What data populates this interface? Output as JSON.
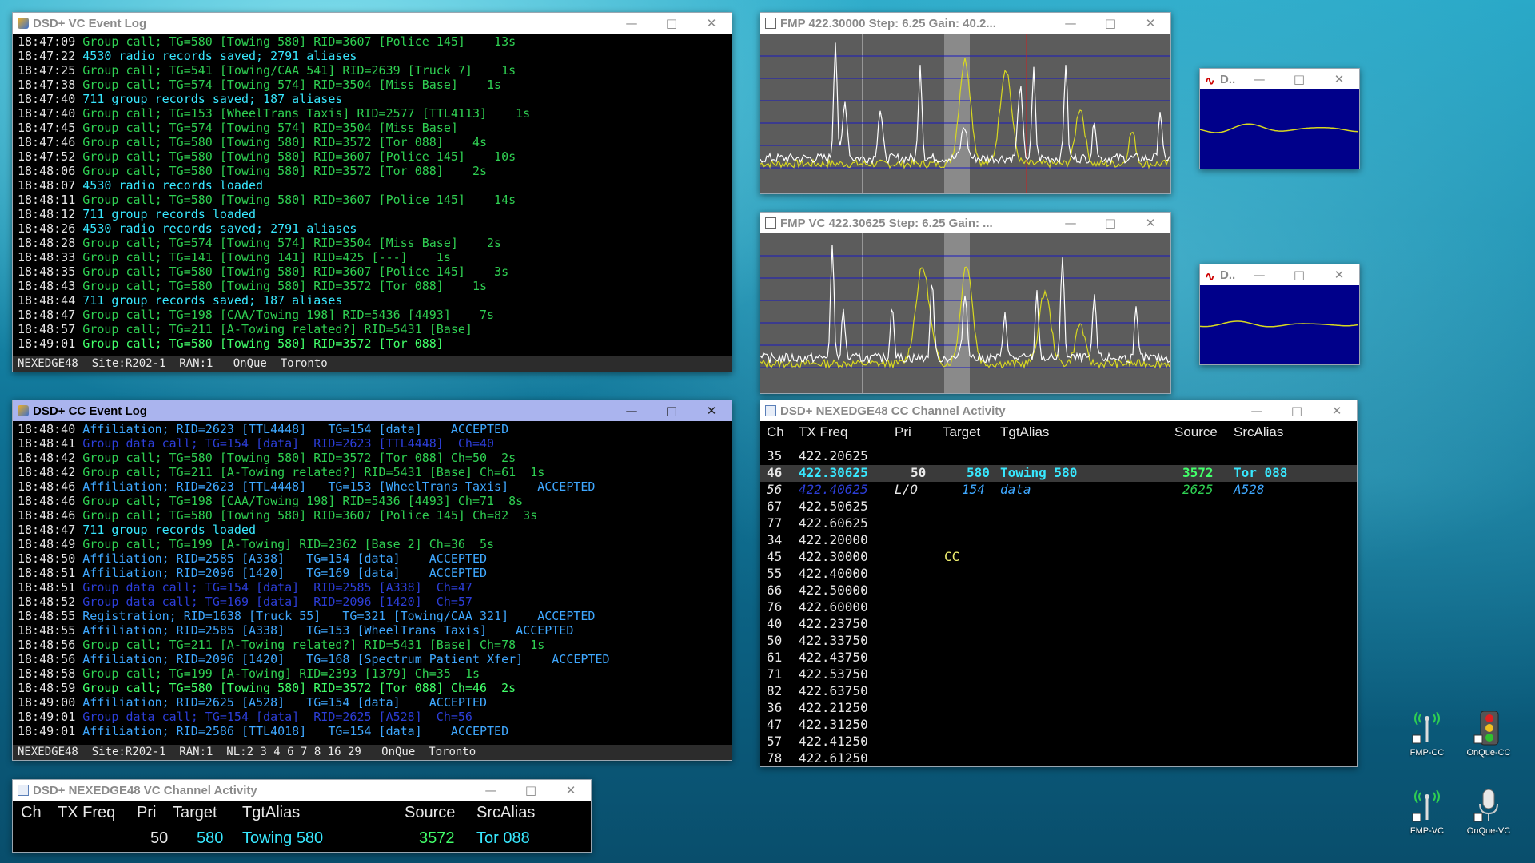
{
  "vc_log": {
    "title": "DSD+ VC Event Log",
    "lines": [
      {
        "t": "18:47:09",
        "m": "Group call; TG=580 [Towing 580] RID=3607 [Police 145]    13s",
        "c": "green"
      },
      {
        "t": "18:47:22",
        "m": "4530 radio records saved; 2791 aliases",
        "c": "cyan"
      },
      {
        "t": "18:47:25",
        "m": "Group call; TG=541 [Towing/CAA 541] RID=2639 [Truck 7]    1s",
        "c": "green"
      },
      {
        "t": "18:47:38",
        "m": "Group call; TG=574 [Towing 574] RID=3504 [Miss Base]    1s",
        "c": "green"
      },
      {
        "t": "18:47:40",
        "m": "711 group records saved; 187 aliases",
        "c": "cyan"
      },
      {
        "t": "18:47:40",
        "m": "Group call; TG=153 [WheelTrans Taxis] RID=2577 [TTL4113]    1s",
        "c": "green"
      },
      {
        "t": "18:47:45",
        "m": "Group call; TG=574 [Towing 574] RID=3504 [Miss Base]",
        "c": "green"
      },
      {
        "t": "18:47:46",
        "m": "Group call; TG=580 [Towing 580] RID=3572 [Tor 088]    4s",
        "c": "green"
      },
      {
        "t": "18:47:52",
        "m": "Group call; TG=580 [Towing 580] RID=3607 [Police 145]    10s",
        "c": "green"
      },
      {
        "t": "18:48:06",
        "m": "Group call; TG=580 [Towing 580] RID=3572 [Tor 088]    2s",
        "c": "green"
      },
      {
        "t": "18:48:07",
        "m": "4530 radio records loaded",
        "c": "cyan"
      },
      {
        "t": "18:48:11",
        "m": "Group call; TG=580 [Towing 580] RID=3607 [Police 145]    14s",
        "c": "green"
      },
      {
        "t": "18:48:12",
        "m": "711 group records loaded",
        "c": "cyan"
      },
      {
        "t": "18:48:26",
        "m": "4530 radio records saved; 2791 aliases",
        "c": "cyan"
      },
      {
        "t": "18:48:28",
        "m": "Group call; TG=574 [Towing 574] RID=3504 [Miss Base]    2s",
        "c": "green"
      },
      {
        "t": "18:48:33",
        "m": "Group call; TG=141 [Towing 141] RID=425 [---]    1s",
        "c": "green"
      },
      {
        "t": "18:48:35",
        "m": "Group call; TG=580 [Towing 580] RID=3607 [Police 145]    3s",
        "c": "green"
      },
      {
        "t": "18:48:43",
        "m": "Group call; TG=580 [Towing 580] RID=3572 [Tor 088]    1s",
        "c": "green"
      },
      {
        "t": "18:48:44",
        "m": "711 group records saved; 187 aliases",
        "c": "cyan"
      },
      {
        "t": "18:48:47",
        "m": "Group call; TG=198 [CAA/Towing 198] RID=5436 [4493]    7s",
        "c": "green"
      },
      {
        "t": "18:48:57",
        "m": "Group call; TG=211 [A-Towing related?] RID=5431 [Base]",
        "c": "green"
      },
      {
        "t": "18:49:01",
        "m": "Group call; TG=580 [Towing 580] RID=3572 [Tor 088]",
        "c": "bright"
      }
    ],
    "status": "NEXEDGE48  Site:R202-1  RAN:1   OnQue  Toronto"
  },
  "cc_log": {
    "title": "DSD+ CC Event Log",
    "lines": [
      {
        "t": "18:48:40",
        "m": "Affiliation; RID=2623 [TTL4448]   TG=154 [data]    ACCEPTED",
        "c": "aff"
      },
      {
        "t": "18:48:41",
        "m": "Group data call; TG=154 [data]  RID=2623 [TTL4448]  Ch=40",
        "c": "blue"
      },
      {
        "t": "18:48:42",
        "m": "Group call; TG=580 [Towing 580] RID=3572 [Tor 088] Ch=50  2s",
        "c": "green"
      },
      {
        "t": "18:48:42",
        "m": "Group call; TG=211 [A-Towing related?] RID=5431 [Base] Ch=61  1s",
        "c": "green"
      },
      {
        "t": "18:48:46",
        "m": "Affiliation; RID=2623 [TTL4448]   TG=153 [WheelTrans Taxis]    ACCEPTED",
        "c": "aff"
      },
      {
        "t": "18:48:46",
        "m": "Group call; TG=198 [CAA/Towing 198] RID=5436 [4493] Ch=71  8s",
        "c": "green"
      },
      {
        "t": "18:48:46",
        "m": "Group call; TG=580 [Towing 580] RID=3607 [Police 145] Ch=82  3s",
        "c": "green"
      },
      {
        "t": "18:48:47",
        "m": "711 group records loaded",
        "c": "cyan"
      },
      {
        "t": "18:48:49",
        "m": "Group call; TG=199 [A-Towing] RID=2362 [Base 2] Ch=36  5s",
        "c": "green"
      },
      {
        "t": "18:48:50",
        "m": "Affiliation; RID=2585 [A338]   TG=154 [data]    ACCEPTED",
        "c": "aff"
      },
      {
        "t": "18:48:51",
        "m": "Affiliation; RID=2096 [1420]   TG=169 [data]    ACCEPTED",
        "c": "aff"
      },
      {
        "t": "18:48:51",
        "m": "Group data call; TG=154 [data]  RID=2585 [A338]  Ch=47",
        "c": "blue"
      },
      {
        "t": "18:48:52",
        "m": "Group data call; TG=169 [data]  RID=2096 [1420]  Ch=57",
        "c": "blue"
      },
      {
        "t": "18:48:55",
        "m": "Registration; RID=1638 [Truck 55]   TG=321 [Towing/CAA 321]    ACCEPTED",
        "c": "aff"
      },
      {
        "t": "18:48:55",
        "m": "Affiliation; RID=2585 [A338]   TG=153 [WheelTrans Taxis]    ACCEPTED",
        "c": "aff"
      },
      {
        "t": "18:48:56",
        "m": "Group call; TG=211 [A-Towing related?] RID=5431 [Base] Ch=78  1s",
        "c": "green"
      },
      {
        "t": "18:48:56",
        "m": "Affiliation; RID=2096 [1420]   TG=168 [Spectrum Patient Xfer]    ACCEPTED",
        "c": "aff"
      },
      {
        "t": "18:48:58",
        "m": "Group call; TG=199 [A-Towing] RID=2393 [1379] Ch=35  1s",
        "c": "green"
      },
      {
        "t": "18:48:59",
        "m": "Group call; TG=580 [Towing 580] RID=3572 [Tor 088] Ch=46  2s",
        "c": "bright"
      },
      {
        "t": "18:49:00",
        "m": "Affiliation; RID=2625 [A528]   TG=154 [data]    ACCEPTED",
        "c": "aff"
      },
      {
        "t": "18:49:01",
        "m": "Group data call; TG=154 [data]  RID=2625 [A528]  Ch=56",
        "c": "blue"
      },
      {
        "t": "18:49:01",
        "m": "Affiliation; RID=2586 [TTL4018]   TG=154 [data]    ACCEPTED",
        "c": "aff"
      }
    ],
    "status": "NEXEDGE48  Site:R202-1  RAN:1  NL:2 3 4 6 7 8 16 29   OnQue  Toronto"
  },
  "fmp1": {
    "title": "FMP  422.30000  Step: 6.25  Gain: 40.2..."
  },
  "fmp2": {
    "title": "FMP  VC  422.30625  Step: 6.25  Gain: ..."
  },
  "scope1": {
    "title": "D.."
  },
  "scope2": {
    "title": "D.."
  },
  "cc_activity": {
    "title": "DSD+ NEXEDGE48 CC Channel Activity",
    "headers": {
      "ch": "Ch",
      "freq": "TX Freq",
      "pri": "Pri",
      "target": "Target",
      "tgtalias": "TgtAlias",
      "source": "Source",
      "srcalias": "SrcAlias"
    },
    "rows": [
      {
        "ch": "35",
        "freq": "422.20625"
      },
      {
        "ch": "46",
        "freq": "422.30625",
        "pri": "50",
        "target": "580",
        "tgtalias": "Towing 580",
        "source": "3572",
        "srcalias": "Tor 088",
        "style": "active"
      },
      {
        "ch": "56",
        "freq": "422.40625",
        "pri": "L/O",
        "target": "154",
        "tgtalias": "data",
        "source": "2625",
        "srcalias": "A528",
        "style": "data"
      },
      {
        "ch": "67",
        "freq": "422.50625"
      },
      {
        "ch": "77",
        "freq": "422.60625"
      },
      {
        "ch": "34",
        "freq": "422.20000"
      },
      {
        "ch": "45",
        "freq": "422.30000",
        "target": "CC",
        "style": "cc"
      },
      {
        "ch": "55",
        "freq": "422.40000"
      },
      {
        "ch": "66",
        "freq": "422.50000"
      },
      {
        "ch": "76",
        "freq": "422.60000"
      },
      {
        "ch": "40",
        "freq": "422.23750"
      },
      {
        "ch": "50",
        "freq": "422.33750"
      },
      {
        "ch": "61",
        "freq": "422.43750"
      },
      {
        "ch": "71",
        "freq": "422.53750"
      },
      {
        "ch": "82",
        "freq": "422.63750"
      },
      {
        "ch": "36",
        "freq": "422.21250"
      },
      {
        "ch": "47",
        "freq": "422.31250"
      },
      {
        "ch": "57",
        "freq": "422.41250"
      },
      {
        "ch": "78",
        "freq": "422.61250"
      }
    ]
  },
  "vc_activity": {
    "title": "DSD+ NEXEDGE48 VC Channel Activity",
    "headers": {
      "ch": "Ch",
      "freq": "TX Freq",
      "pri": "Pri",
      "target": "Target",
      "tgtalias": "TgtAlias",
      "source": "Source",
      "srcalias": "SrcAlias"
    },
    "row": {
      "pri": "50",
      "target": "580",
      "tgtalias": "Towing 580",
      "source": "3572",
      "srcalias": "Tor 088"
    }
  },
  "desktop_icons": [
    {
      "label": "FMP-CC",
      "icon": "antenna-icon"
    },
    {
      "label": "OnQue-CC",
      "icon": "traffic-light-icon"
    },
    {
      "label": "FMP-VC",
      "icon": "antenna-icon"
    },
    {
      "label": "OnQue-VC",
      "icon": "microphone-icon"
    }
  ],
  "colors": {
    "green": "#2fcf52",
    "cyan": "#38e8ff",
    "blue": "#2c3ed8",
    "affiliation": "#3fa8ff",
    "trace_white": "#ffffff",
    "trace_yellow": "#d8d820",
    "scope_bg": "#00008a"
  }
}
